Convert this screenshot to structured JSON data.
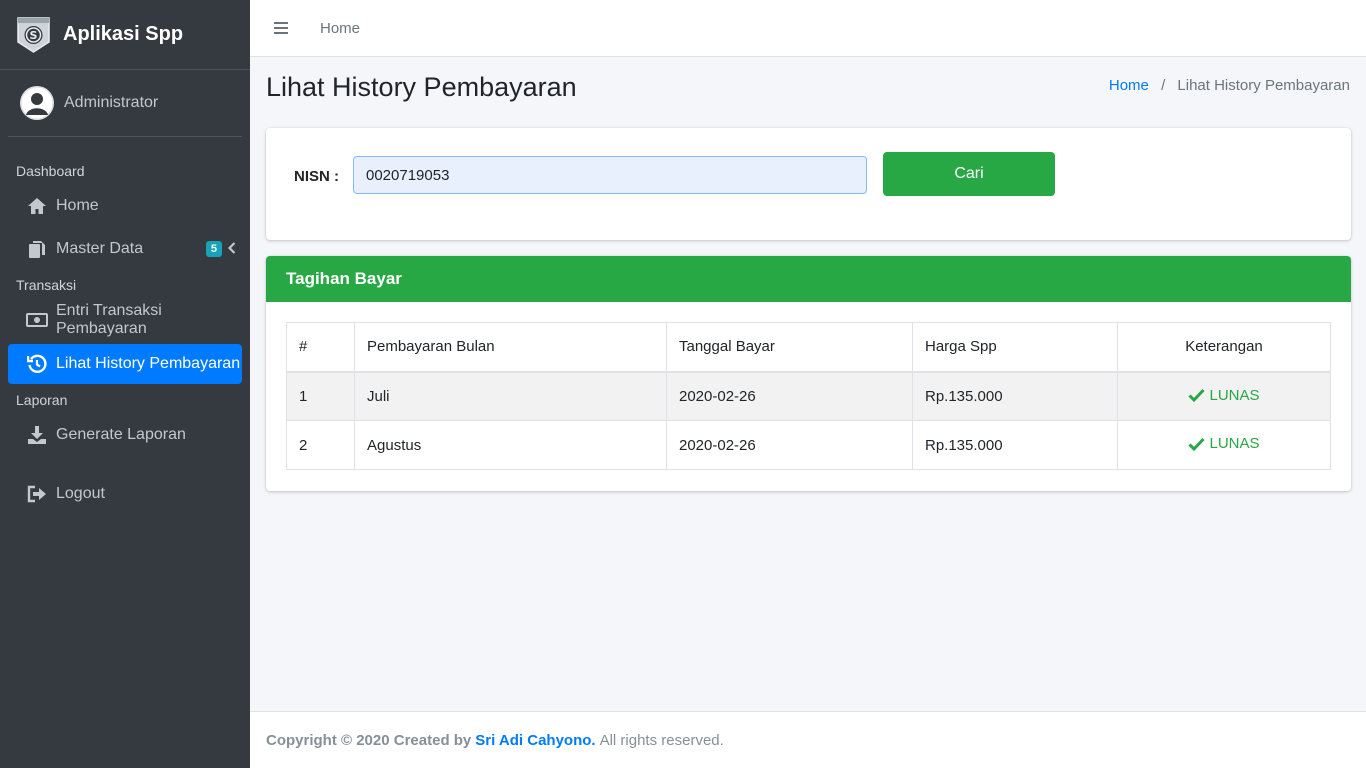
{
  "brand": {
    "name": "Aplikasi Spp",
    "logo_icon": "spp-logo-icon"
  },
  "user": {
    "name": "Administrator",
    "avatar_icon": "user-avatar-icon"
  },
  "sidebar": {
    "sections": [
      {
        "header": "Dashboard"
      },
      {
        "header": "Transaksi"
      },
      {
        "header": "Laporan"
      }
    ],
    "items": [
      {
        "label": "Home",
        "icon": "home-icon"
      },
      {
        "label": "Master Data",
        "icon": "copy-icon",
        "badge": "5"
      },
      {
        "label": "Entri Transaksi Pembayaran",
        "icon": "money-icon"
      },
      {
        "label": "Lihat History Pembayaran",
        "icon": "history-icon",
        "active": true
      },
      {
        "label": "Generate Laporan",
        "icon": "download-icon"
      },
      {
        "label": "Logout",
        "icon": "sign-out-icon"
      }
    ]
  },
  "topbar": {
    "menu_icon": "bars-icon",
    "home_link": "Home"
  },
  "page": {
    "title": "Lihat History Pembayaran",
    "breadcrumb": {
      "home": "Home",
      "separator": "/",
      "current": "Lihat History Pembayaran"
    }
  },
  "search": {
    "label": "NISN :",
    "value": "0020719053",
    "button": "Cari"
  },
  "billing": {
    "title": "Tagihan Bayar",
    "columns": [
      "#",
      "Pembayaran Bulan",
      "Tanggal Bayar",
      "Harga Spp",
      "Keterangan"
    ],
    "rows": [
      {
        "no": "1",
        "bulan": "Juli",
        "tanggal": "2020-02-26",
        "harga": "Rp.135.000",
        "status": "LUNAS"
      },
      {
        "no": "2",
        "bulan": "Agustus",
        "tanggal": "2020-02-26",
        "harga": "Rp.135.000",
        "status": "LUNAS"
      }
    ]
  },
  "footer": {
    "prefix": "Copyright © 2020 Created by",
    "author": "Sri Adi Cahyono.",
    "suffix": "All rights reserved."
  },
  "colors": {
    "sidebar_bg": "#343a40",
    "active": "#007bff",
    "success": "#28a745",
    "badge": "#17a2b8"
  }
}
